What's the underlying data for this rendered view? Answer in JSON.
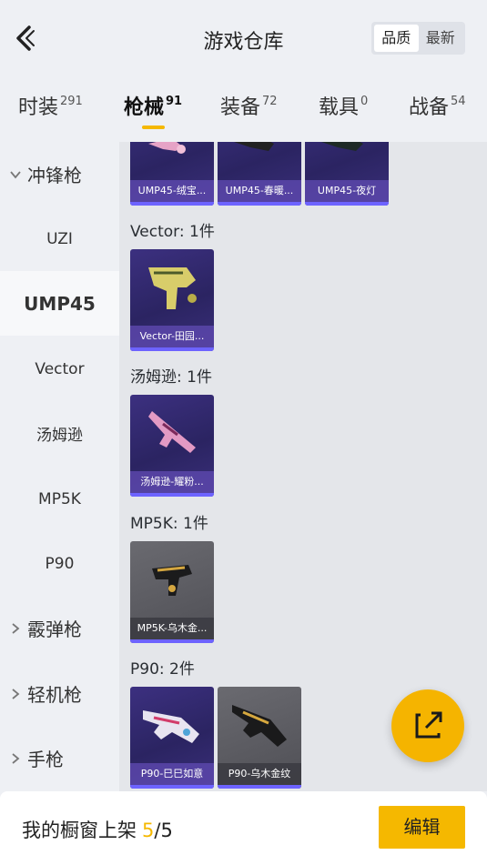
{
  "header": {
    "title": "游戏仓库",
    "sort_options": [
      "品质",
      "最新"
    ],
    "active_sort": "品质"
  },
  "tabs": [
    {
      "label": "时装",
      "count": "291"
    },
    {
      "label": "枪械",
      "count": "91"
    },
    {
      "label": "装备",
      "count": "72"
    },
    {
      "label": "载具",
      "count": "0"
    },
    {
      "label": "战备",
      "count": "54"
    }
  ],
  "active_tab": "枪械",
  "sidebar": {
    "groups": [
      {
        "label": "冲锋枪",
        "expanded": true
      },
      {
        "label": "霰弹枪",
        "expanded": false
      },
      {
        "label": "轻机枪",
        "expanded": false
      },
      {
        "label": "手枪",
        "expanded": false
      }
    ],
    "subitems": [
      "UZI",
      "UMP45",
      "Vector",
      "汤姆逊",
      "MP5K",
      "P90"
    ],
    "selected": "UMP45"
  },
  "content": {
    "top_row": [
      {
        "name": "UMP45-绒宝...",
        "style": "purple"
      },
      {
        "name": "UMP45-春暖...",
        "style": "purple"
      },
      {
        "name": "UMP45-夜灯",
        "style": "purple"
      }
    ],
    "sections": [
      {
        "title": "Vector: 1件",
        "items": [
          {
            "name": "Vector-田园...",
            "style": "purple"
          }
        ]
      },
      {
        "title": "汤姆逊: 1件",
        "items": [
          {
            "name": "汤姆逊-耀粉...",
            "style": "purple"
          }
        ]
      },
      {
        "title": "MP5K: 1件",
        "items": [
          {
            "name": "MP5K-乌木金...",
            "style": "grey"
          }
        ]
      },
      {
        "title": "P90: 2件",
        "items": [
          {
            "name": "P90-巳巳如意",
            "style": "purple"
          },
          {
            "name": "P90-乌木金纹",
            "style": "grey"
          }
        ]
      }
    ]
  },
  "footer": {
    "label": "我的橱窗上架",
    "used": "5",
    "total": "/5",
    "edit_label": "编辑"
  },
  "colors": {
    "accent": "#f5b800",
    "card_purple": "#2b2462",
    "card_grey": "#55555b"
  }
}
